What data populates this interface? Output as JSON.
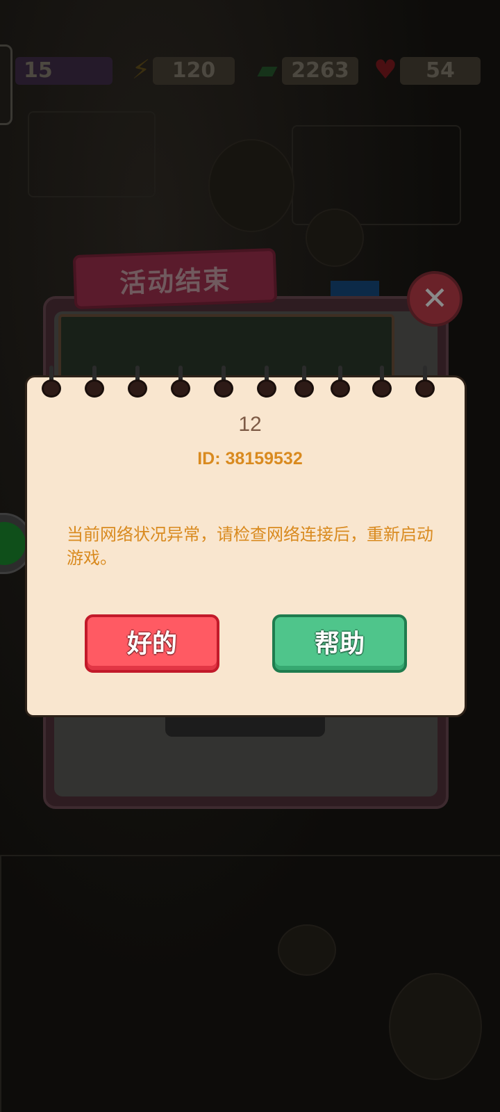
{
  "hud": {
    "level": "15",
    "energy": "120",
    "cash": "2263",
    "gems": "54"
  },
  "event_panel": {
    "banner_title": "活动结束"
  },
  "dialog": {
    "code": "12",
    "id_line": "ID: 38159532",
    "message": "当前网络状况异常，请检查网络连接后，重新启动游戏。",
    "ok_label": "好的",
    "help_label": "帮助"
  },
  "colors": {
    "paper": "#f9e6cf",
    "accent_orange": "#d98a1f",
    "ok_red": "#ff5a63",
    "help_green": "#4fc58b"
  },
  "icons": {
    "close": "close-icon",
    "energy": "lightning-icon",
    "cash": "cash-icon",
    "gems": "heart-gem-icon",
    "wechat": "wechat-icon"
  }
}
